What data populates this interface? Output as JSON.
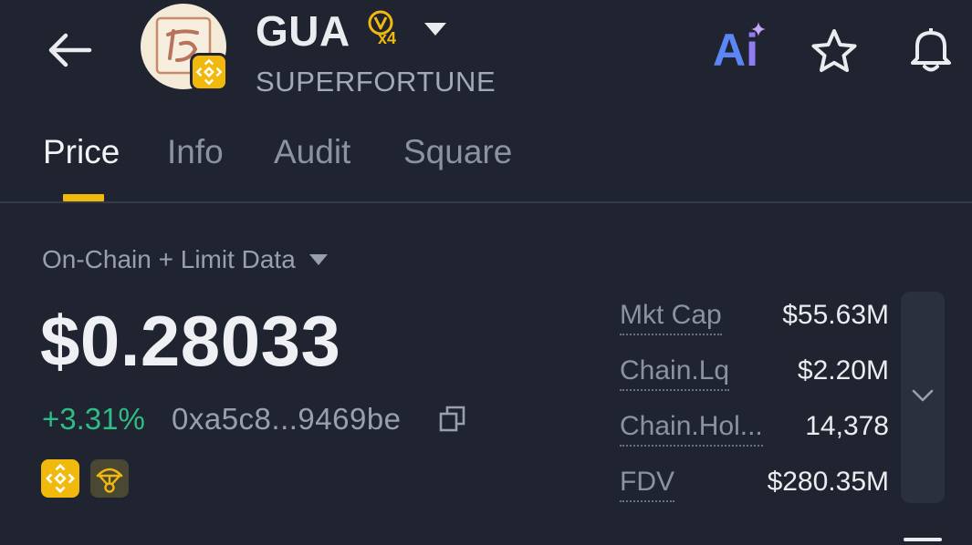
{
  "header": {
    "ticker": "GUA",
    "badge_multiplier": "x4",
    "full_name": "SUPERFORTUNE",
    "ai_label_a": "A",
    "ai_label_i": "i"
  },
  "tabs": [
    {
      "label": "Price",
      "active": true
    },
    {
      "label": "Info",
      "active": false
    },
    {
      "label": "Audit",
      "active": false
    },
    {
      "label": "Square",
      "active": false
    }
  ],
  "price_section": {
    "data_source": "On-Chain + Limit Data",
    "price": "$0.28033",
    "change_percent": "+3.31%",
    "contract_address": "0xa5c8...9469be",
    "tags": [
      "bnb-chain-icon",
      "airdrop-icon"
    ]
  },
  "stats": [
    {
      "label": "Mkt Cap",
      "value": "$55.63M"
    },
    {
      "label": "Chain.Lq",
      "value": "$2.20M"
    },
    {
      "label": "Chain.Hol...",
      "value": "14,378"
    },
    {
      "label": "FDV",
      "value": "$280.35M"
    }
  ],
  "colors": {
    "background": "#1f2430",
    "accent": "#f0b90b",
    "positive": "#2ebd85",
    "muted_text": "#8c93a0"
  }
}
